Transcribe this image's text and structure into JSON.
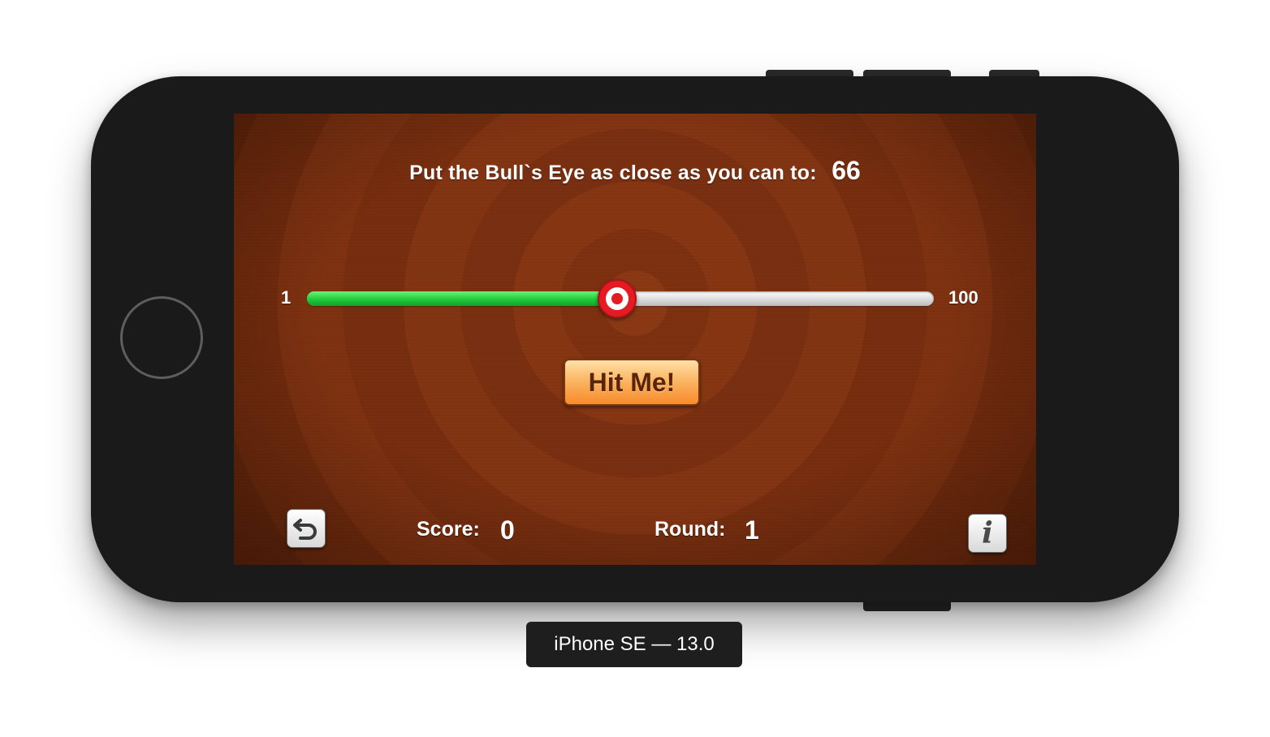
{
  "device": {
    "caption": "iPhone SE — 13.0"
  },
  "game": {
    "target_label": "Put the Bull`s Eye as close as you can to:",
    "target_value": "66",
    "slider": {
      "min_label": "1",
      "max_label": "100",
      "value": 50,
      "min": 1,
      "max": 100
    },
    "hit_button_label": "Hit Me!",
    "score_label": "Score:",
    "score_value": "0",
    "round_label": "Round:",
    "round_value": "1",
    "restart_icon": "restart-arrow-icon",
    "info_icon": "info-icon",
    "info_glyph": "i"
  },
  "colors": {
    "background_brown": "#8a3914",
    "slider_fill_green": "#1fca3a",
    "thumb_red": "#e51b24",
    "button_orange": "#fbb665"
  }
}
